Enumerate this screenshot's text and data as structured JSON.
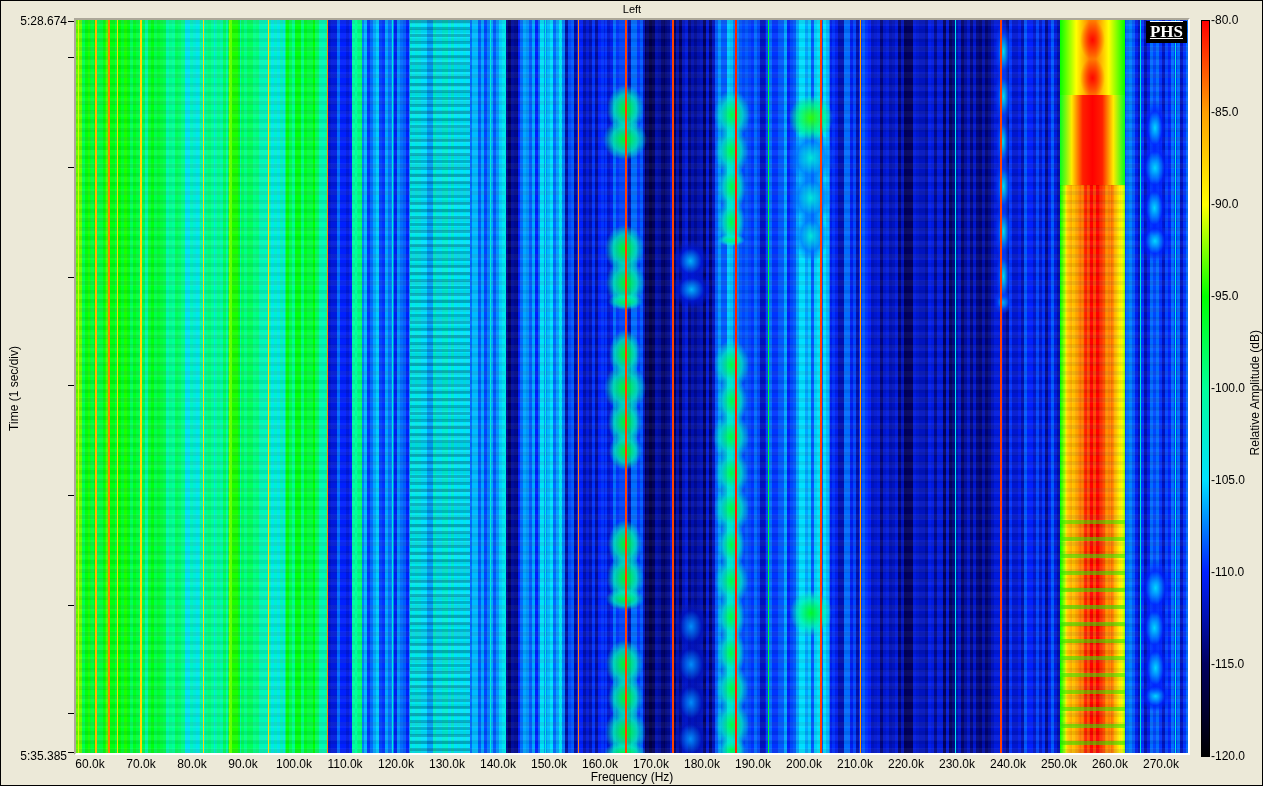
{
  "plot": {
    "title": "Left",
    "logo": "PHS",
    "y_axis": {
      "title": "Time (1 sec/div)",
      "labels": [
        "5:28.674",
        "5:35.385"
      ]
    },
    "x_axis": {
      "title": "Frequency (Hz)",
      "labels": [
        "60.0k",
        "70.0k",
        "80.0k",
        "90.0k",
        "100.0k",
        "110.0k",
        "120.0k",
        "130.0k",
        "140.0k",
        "150.0k",
        "160.0k",
        "170.0k",
        "180.0k",
        "190.0k",
        "200.0k",
        "210.0k",
        "220.0k",
        "230.0k",
        "240.0k",
        "250.0k",
        "260.0k",
        "270.0k"
      ]
    }
  },
  "color_scale": {
    "title": "Relative Amplitude (dB)",
    "labels": [
      "-80.0",
      "-85.0",
      "-90.0",
      "-95.0",
      "-100.0",
      "-105.0",
      "-110.0",
      "-115.0",
      "-120.0"
    ]
  }
}
